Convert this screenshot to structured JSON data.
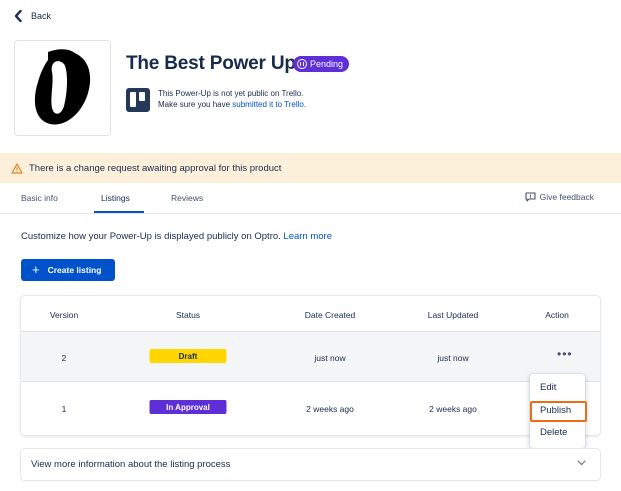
{
  "nav": {
    "back_label": "Back"
  },
  "product": {
    "title": "The Best Power Up",
    "status_badge": "Pending",
    "notice_line1": "This Power-Up is not yet public on Trello.",
    "notice_line2_prefix": "Make sure you have ",
    "notice_line2_link": "submitted it to Trello",
    "notice_line2_suffix": "."
  },
  "banner": {
    "text": "There is a change request awaiting approval for this product",
    "icon": "warning-icon"
  },
  "tabs": [
    {
      "label": "Basic info",
      "active": false
    },
    {
      "label": "Listings",
      "active": true
    },
    {
      "label": "Reviews",
      "active": false
    }
  ],
  "feedback": {
    "label": "Give feedback",
    "icon": "feedback-icon"
  },
  "intro": {
    "text": "Customize how your Power-Up is displayed publicly on Optro. ",
    "link": "Learn more"
  },
  "create_button": {
    "icon": "+",
    "label": "Create listing"
  },
  "table": {
    "headers": [
      "Version",
      "Status",
      "Date Created",
      "Last Updated",
      "Action"
    ],
    "rows": [
      {
        "version": "2",
        "status": "Draft",
        "created": "just now",
        "updated": "just now",
        "action": "•••"
      },
      {
        "version": "1",
        "status": "In Approval",
        "created": "2 weeks ago",
        "updated": "2 weeks ago",
        "action": ""
      }
    ]
  },
  "action_menu": {
    "items": [
      "Edit",
      "Publish",
      "Delete"
    ],
    "highlighted": "Publish"
  },
  "accordion": {
    "label": "View more information about the listing process"
  },
  "colors": {
    "primary": "#0052cc",
    "pending": "#5e2ed6",
    "draft": "#ffd600",
    "banner": "#fdf0db",
    "highlight": "#ef6c17"
  }
}
